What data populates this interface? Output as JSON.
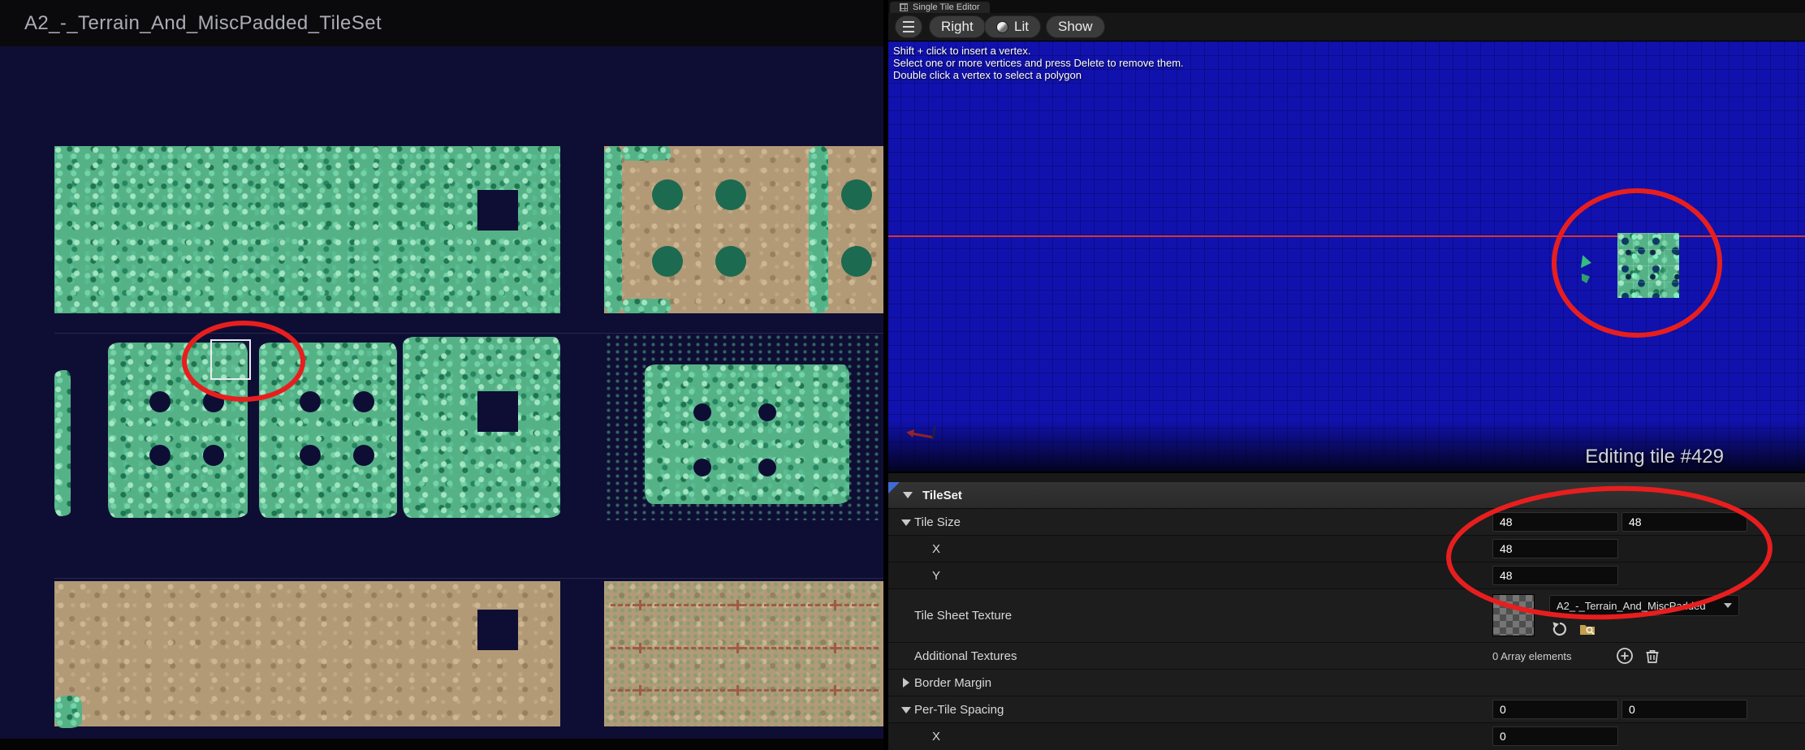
{
  "left_panel": {
    "title": "A2_-_Terrain_And_MiscPadded_TileSet"
  },
  "tile_editor": {
    "tab_label": "Single Tile Editor",
    "toolbar": {
      "right_label": "Right",
      "lit_label": "Lit",
      "show_label": "Show"
    },
    "instructions": [
      "Shift + click to insert a vertex.",
      "Select one or more vertices and press Delete to remove them.",
      "Double click a vertex to select a polygon"
    ],
    "status_text": "Editing tile #429"
  },
  "details": {
    "category_label": "TileSet",
    "tile_size": {
      "label": "Tile Size",
      "width": "48",
      "height": "48"
    },
    "tile_size_x": {
      "label": "X",
      "value": "48"
    },
    "tile_size_y": {
      "label": "Y",
      "value": "48"
    },
    "tile_sheet_texture": {
      "label": "Tile Sheet Texture",
      "asset_name": "A2_-_Terrain_And_MiscPadded"
    },
    "additional_textures": {
      "label": "Additional Textures",
      "value": "0 Array elements"
    },
    "border_margin": {
      "label": "Border Margin"
    },
    "per_tile_spacing": {
      "label": "Per-Tile Spacing",
      "width": "0",
      "height": "0"
    },
    "per_tile_spacing_x": {
      "label": "X",
      "value": "0"
    }
  },
  "colors": {
    "annotation_red": "#e81e1e",
    "viewport_blue": "#1112ae",
    "grass_green": "#55b286",
    "dirt_tan": "#b39a77",
    "selection_white": "#eaecf2"
  },
  "icons": {
    "hamburger-icon": "three horizontal bars",
    "lit-sphere-icon": "half-shaded circle",
    "chevron-down-icon": "small down triangle",
    "expander-open-icon": "down triangle",
    "expander-closed-icon": "right triangle",
    "use-selected-asset-icon": "circular arrow",
    "browse-to-asset-icon": "folder with magnifier",
    "add-element-icon": "plus in circle",
    "delete-element-icon": "trash can"
  }
}
